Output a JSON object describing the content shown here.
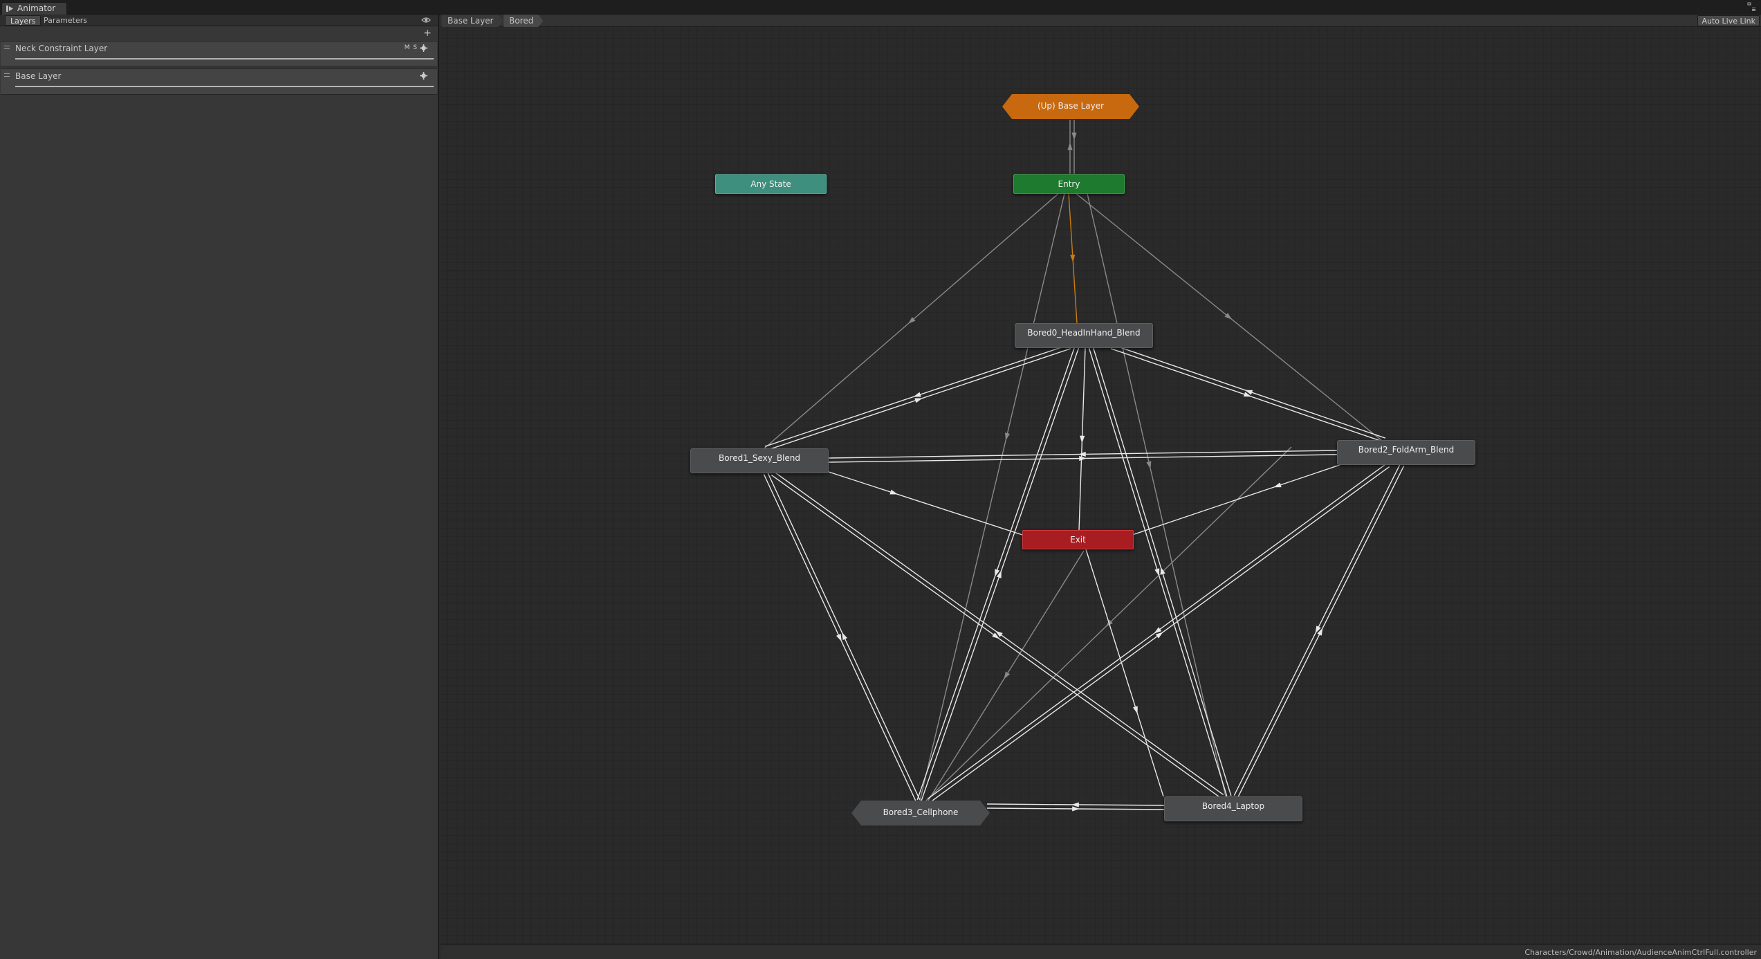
{
  "window": {
    "tab_label": "Animator"
  },
  "panel": {
    "tabs": [
      "Layers",
      "Parameters"
    ],
    "add_label": "+",
    "layers": [
      {
        "name": "Neck Constraint Layer",
        "badge": "M S"
      },
      {
        "name": "Base Layer",
        "badge": ""
      }
    ]
  },
  "breadcrumb": [
    "Base Layer",
    "Bored"
  ],
  "auto_live_link": "Auto Live Link",
  "nodes": {
    "up": "(Up) Base Layer",
    "any": "Any State",
    "entry": "Entry",
    "exit": "Exit",
    "bored0": "Bored0_HeadInHand_Blend",
    "bored1": "Bored1_Sexy_Blend",
    "bored2": "Bored2_FoldArm_Blend",
    "bored3": "Bored3_Cellphone",
    "bored4": "Bored4_Laptop"
  },
  "status_path": "Characters/Crowd/Animation/AudienceAnimCtrlFull.controller",
  "colors": {
    "entry": "#1d7a2e",
    "any_state": "#3f8f7e",
    "exit": "#a81d21",
    "up_state": "#c8690f",
    "default_transition": "#c87d14"
  }
}
